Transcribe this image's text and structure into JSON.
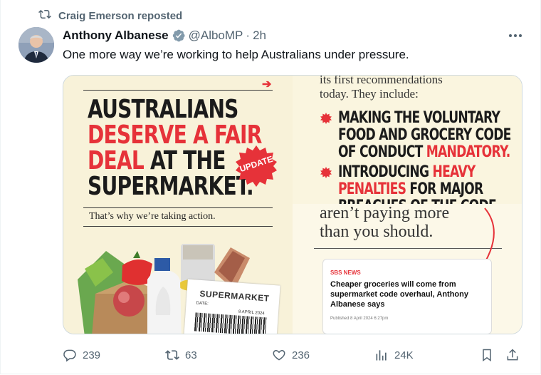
{
  "repost": {
    "label": "Craig Emerson reposted"
  },
  "author": {
    "name": "Anthony Albanese",
    "handle": "@AlboMP",
    "separator": "·",
    "time": "2h"
  },
  "tweet": {
    "text": "One more way we’re working to help Australians under pressure."
  },
  "media": {
    "headline": {
      "line1": "AUSTRALIANS",
      "line2": "DESERVE A FAIR",
      "line3a": "DEAL",
      "line3b": "AT THE",
      "line4": "SUPERMARKET."
    },
    "badge": "UPDATE",
    "subtitle": "That’s why we’re taking action.",
    "panel_right_top": {
      "intro_line1": "its first recommendations",
      "intro_line2": "today. They include:",
      "item1_line1": "MAKING THE VOLUNTARY",
      "item1_line2": "FOOD AND GROCERY CODE",
      "item1_line3a": "OF CONDUCT",
      "item1_line3b": "MANDATORY.",
      "item2_line1a": "INTRODUCING",
      "item2_line1b": "HEAVY",
      "item2_line2a": "PENALTIES",
      "item2_line2b": "FOR MAJOR",
      "item2_line3": "BREACHES OF THE CODE"
    },
    "panel_right_bottom": {
      "line1": "aren’t paying more",
      "line2": "than you should.",
      "news": {
        "source": "SBS NEWS",
        "headline": "Cheaper groceries will come from supermarket code overhaul, Anthony Albanese says",
        "published": "Published 8 April 2024 6:27pm"
      }
    },
    "receipt": {
      "title": "SUPERMARKET",
      "date_label": "DATE:",
      "date_value": "8 APRIL 2024"
    }
  },
  "actions": {
    "replies": "239",
    "reposts": "63",
    "likes": "236",
    "views": "24K"
  },
  "colors": {
    "accent_red": "#e63239",
    "muted": "#536471",
    "verified": "#829aab",
    "text": "#0f1419"
  }
}
